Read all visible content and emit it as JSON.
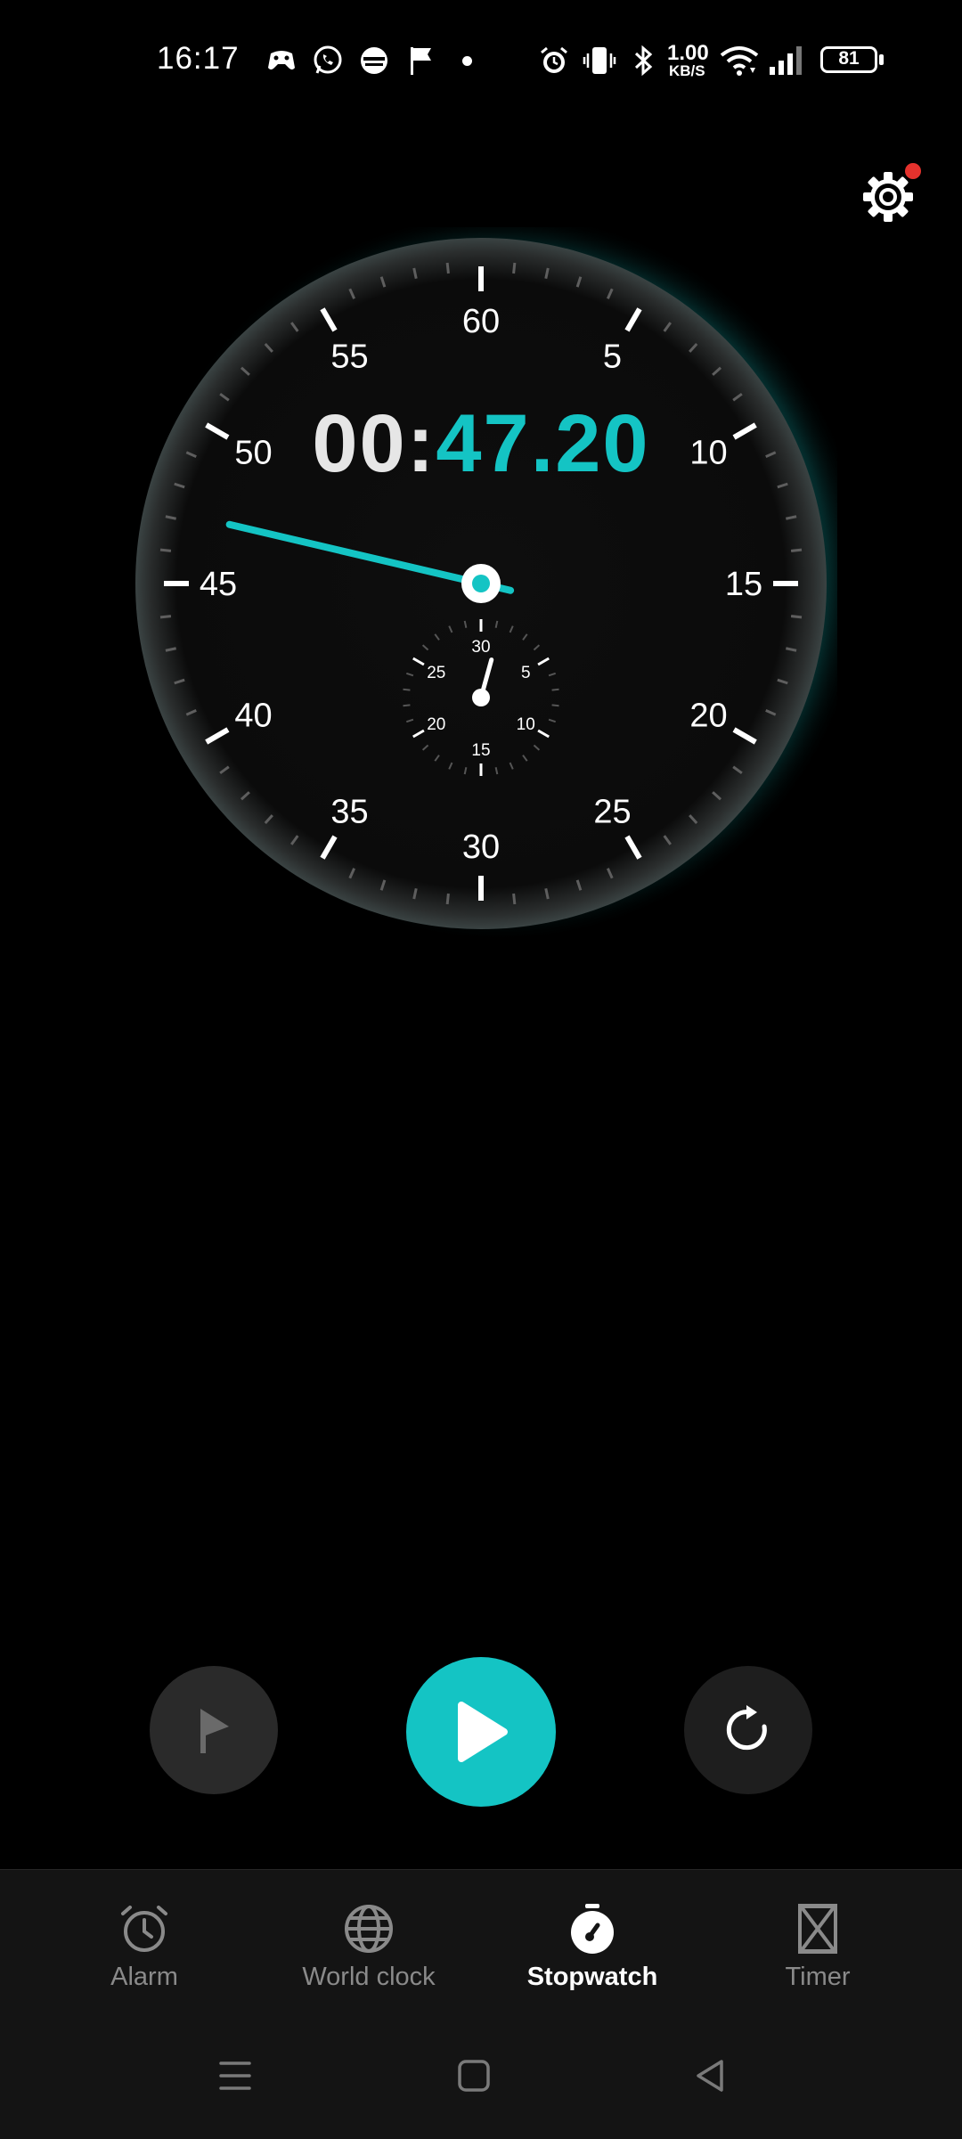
{
  "status_bar": {
    "time": "16:17",
    "net_speed_value": "1.00",
    "net_speed_unit": "KB/S",
    "battery": "81",
    "notification_icons": [
      "game-controller-icon",
      "whatsapp-icon",
      "app-icon",
      "flag-icon",
      "dot-icon"
    ],
    "system_icons": [
      "alarm-icon",
      "vibrate-icon",
      "bluetooth-icon",
      "wifi-icon",
      "signal-icon",
      "battery-icon"
    ]
  },
  "stopwatch": {
    "minutes": "00:",
    "seconds": "47.20",
    "elapsed_seconds": 47.2,
    "main_dial_labels": [
      "60",
      "5",
      "10",
      "15",
      "20",
      "25",
      "30",
      "35",
      "40",
      "45",
      "50",
      "55"
    ],
    "sub_dial_labels": [
      "30",
      "5",
      "10",
      "15",
      "20",
      "25"
    ],
    "sub_dial_value_minutes": 0.79,
    "accent_color": "#14c4c4"
  },
  "controls": {
    "lap": {
      "icon": "flag-icon",
      "enabled": false
    },
    "start": {
      "icon": "play-icon"
    },
    "reset": {
      "icon": "reset-icon"
    }
  },
  "tabs": [
    {
      "label": "Alarm",
      "icon": "alarm-clock-icon",
      "active": false
    },
    {
      "label": "World clock",
      "icon": "globe-icon",
      "active": false
    },
    {
      "label": "Stopwatch",
      "icon": "stopwatch-icon",
      "active": true
    },
    {
      "label": "Timer",
      "icon": "hourglass-icon",
      "active": false
    }
  ],
  "system_nav": [
    "menu-icon",
    "home-icon",
    "back-icon"
  ],
  "settings": {
    "icon": "gear-icon",
    "has_badge": true,
    "badge_color": "#e5322d"
  }
}
